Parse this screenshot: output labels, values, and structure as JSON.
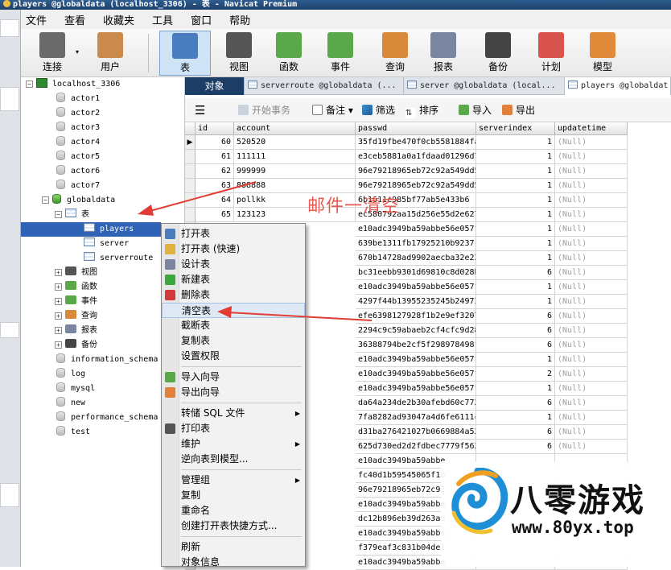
{
  "window": {
    "title": "players @globaldata (localhost_3306) - 表 - Navicat Premium"
  },
  "menu": [
    "文件",
    "查看",
    "收藏夹",
    "工具",
    "窗口",
    "帮助"
  ],
  "toolbar": [
    {
      "id": "connect",
      "label": "连接",
      "icon": "plug-icon"
    },
    {
      "id": "user",
      "label": "用户",
      "icon": "user-icon"
    },
    {
      "id": "table",
      "label": "表",
      "icon": "table-icon",
      "active": true
    },
    {
      "id": "view",
      "label": "视图",
      "icon": "glasses-icon"
    },
    {
      "id": "function",
      "label": "函数",
      "icon": "function-icon"
    },
    {
      "id": "event",
      "label": "事件",
      "icon": "clock-icon"
    },
    {
      "id": "query",
      "label": "查询",
      "icon": "query-icon"
    },
    {
      "id": "report",
      "label": "报表",
      "icon": "report-icon"
    },
    {
      "id": "backup",
      "label": "备份",
      "icon": "tape-icon"
    },
    {
      "id": "schedule",
      "label": "计划",
      "icon": "calendar-icon"
    },
    {
      "id": "model",
      "label": "模型",
      "icon": "model-icon"
    }
  ],
  "tree": {
    "connection": "localhost_3306",
    "databases_top": [
      "actor1",
      "actor2",
      "actor3",
      "actor4",
      "actor5",
      "actor6",
      "actor7"
    ],
    "globaldata": "globaldata",
    "tables_node": "表",
    "tables": [
      "players",
      "server",
      "serverroute"
    ],
    "folders": [
      "视图",
      "函数",
      "事件",
      "查询",
      "报表",
      "备份"
    ],
    "databases_bottom": [
      "information_schema",
      "log",
      "mysql",
      "new",
      "performance_schema",
      "test"
    ]
  },
  "tabs": [
    {
      "label": "对象"
    },
    {
      "label": "serverroute @globaldata (..."
    },
    {
      "label": "server @globaldata (local..."
    },
    {
      "label": "players @globaldat"
    }
  ],
  "grid_toolbar": {
    "begin_tx": "开始事务",
    "memo": "备注",
    "filter": "筛选",
    "sort": "排序",
    "import": "导入",
    "export": "导出"
  },
  "columns": [
    "id",
    "account",
    "passwd",
    "serverindex",
    "updatetime"
  ],
  "rows": [
    {
      "id": "60",
      "account": "520520",
      "passwd": "35fd19fbe470f0cb5581884fa",
      "serverindex": "1",
      "updatetime": "(Null)"
    },
    {
      "id": "61",
      "account": "111111",
      "passwd": "e3ceb5881a0a1fdaad01296d7",
      "serverindex": "1",
      "updatetime": "(Null)"
    },
    {
      "id": "62",
      "account": "999999",
      "passwd": "96e79218965eb72c92a549dd5",
      "serverindex": "1",
      "updatetime": "(Null)"
    },
    {
      "id": "63",
      "account": "888888",
      "passwd": "96e79218965eb72c92a549dd5",
      "serverindex": "1",
      "updatetime": "(Null)"
    },
    {
      "id": "64",
      "account": "pollkk",
      "passwd": "6b1611c985bf77ab5e433b6",
      "serverindex": "1",
      "updatetime": "(Null)"
    },
    {
      "id": "65",
      "account": "123123",
      "passwd": "ec580792aa15d256e55d2e627",
      "serverindex": "1",
      "updatetime": "(Null)"
    },
    {
      "passwd": "e10adc3949ba59abbe56e057f",
      "serverindex": "1",
      "updatetime": "(Null)"
    },
    {
      "passwd": "639be1311fb17925210b9237",
      "serverindex": "1",
      "updatetime": "(Null)"
    },
    {
      "passwd": "670b14728ad9902aecba32e22",
      "serverindex": "1",
      "updatetime": "(Null)"
    },
    {
      "passwd": "bc31eebb9301d69810c8d028b",
      "serverindex": "6",
      "updatetime": "(Null)"
    },
    {
      "passwd": "e10adc3949ba59abbe56e057f",
      "serverindex": "1",
      "updatetime": "(Null)"
    },
    {
      "passwd": "4297f44b13955235245b24973",
      "serverindex": "1",
      "updatetime": "(Null)"
    },
    {
      "passwd": "efe6398127928f1b2e9ef3207",
      "serverindex": "6",
      "updatetime": "(Null)"
    },
    {
      "passwd": "2294c9c59abaeb2cf4cfc9d28",
      "serverindex": "6",
      "updatetime": "(Null)"
    },
    {
      "passwd": "36388794be2cf5f298978498f",
      "serverindex": "6",
      "updatetime": "(Null)"
    },
    {
      "passwd": "e10adc3949ba59abbe56e057f",
      "serverindex": "1",
      "updatetime": "(Null)"
    },
    {
      "passwd": "e10adc3949ba59abbe56e057f",
      "serverindex": "2",
      "updatetime": "(Null)"
    },
    {
      "passwd": "e10adc3949ba59abbe56e057f",
      "serverindex": "1",
      "updatetime": "(Null)"
    },
    {
      "passwd": "da64a234de2b30afebd60c772",
      "serverindex": "6",
      "updatetime": "(Null)"
    },
    {
      "passwd": "7fa8282ad93047a4d6fe6111c",
      "serverindex": "1",
      "updatetime": "(Null)"
    },
    {
      "passwd": "d31ba276421027b0669884a52",
      "serverindex": "6",
      "updatetime": "(Null)"
    },
    {
      "passwd": "625d730ed2d2fdbec7779f562",
      "serverindex": "6",
      "updatetime": "(Null)"
    },
    {
      "passwd": "e10adc3949ba59abbe",
      "serverindex": "",
      "updatetime": ""
    },
    {
      "passwd": "fc40d1b59545065f1b",
      "serverindex": "",
      "updatetime": ""
    },
    {
      "passwd": "96e79218965eb72c92",
      "serverindex": "",
      "updatetime": ""
    },
    {
      "passwd": "e10adc3949ba59abbe",
      "serverindex": "",
      "updatetime": ""
    },
    {
      "passwd": "dc12b896eb39d263ad",
      "serverindex": "",
      "updatetime": ""
    },
    {
      "passwd": "e10adc3949ba59abbe",
      "serverindex": "",
      "updatetime": ""
    },
    {
      "passwd": "f379eaf3c831b04de1",
      "serverindex": "",
      "updatetime": ""
    },
    {
      "passwd": "e10adc3949ba59abbe",
      "serverindex": "",
      "updatetime": ""
    }
  ],
  "context_menu": [
    {
      "label": "打开表",
      "icon": "open-table-icon"
    },
    {
      "label": "打开表 (快速)",
      "icon": "open-table-fast-icon"
    },
    {
      "label": "设计表",
      "icon": "design-table-icon"
    },
    {
      "label": "新建表",
      "icon": "new-table-icon"
    },
    {
      "label": "删除表",
      "icon": "delete-table-icon"
    },
    {
      "label": "清空表",
      "highlight": true
    },
    {
      "label": "截断表"
    },
    {
      "label": "复制表"
    },
    {
      "label": "设置权限"
    },
    {
      "sep": true
    },
    {
      "label": "导入向导",
      "icon": "import-icon"
    },
    {
      "label": "导出向导",
      "icon": "export-icon"
    },
    {
      "sep": true
    },
    {
      "label": "转储 SQL 文件",
      "submenu": true
    },
    {
      "label": "打印表",
      "icon": "printer-icon"
    },
    {
      "label": "维护",
      "submenu": true
    },
    {
      "label": "逆向表到模型..."
    },
    {
      "sep": true
    },
    {
      "label": "管理组",
      "submenu": true
    },
    {
      "label": "复制"
    },
    {
      "label": "重命名"
    },
    {
      "label": "创建打开表快捷方式..."
    },
    {
      "sep": true
    },
    {
      "label": "刷新"
    },
    {
      "label": "对象信息"
    }
  ],
  "annotation": {
    "text": "邮件一清空"
  },
  "watermark": {
    "brand": "八零游戏",
    "url": "www.80yx.top"
  },
  "colors": {
    "accent": "#3062b6",
    "arrow": "#e23c34",
    "title_bar": "#1d3f6a"
  }
}
